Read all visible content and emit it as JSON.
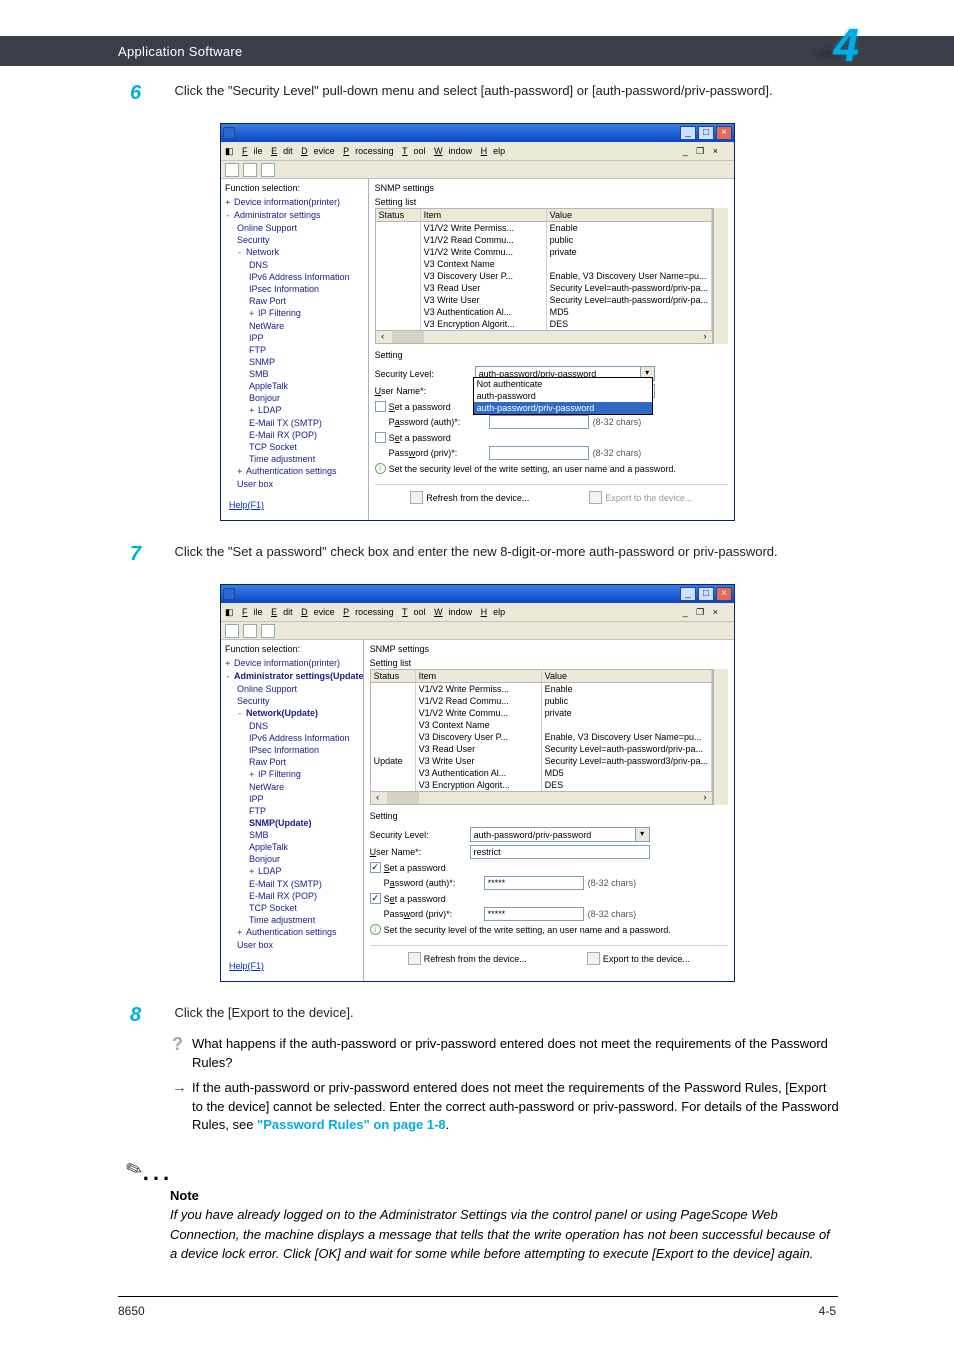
{
  "header": {
    "section": "Application Software",
    "chapter": "4"
  },
  "steps": {
    "s6": {
      "num": "6",
      "text": "Click the \"Security Level\" pull-down menu and select [auth-password] or [auth-password/priv-password]."
    },
    "s7": {
      "num": "7",
      "text": "Click the \"Set a password\" check box and enter the new 8-digit-or-more auth-password or priv-password."
    },
    "s8": {
      "num": "8",
      "text": "Click the [Export to the device].",
      "q": "What happens if the auth-password or priv-password entered does not meet the requirements of the Password Rules?",
      "a_pre": "If the auth-password or priv-password entered does not meet the requirements of the Password Rules, [Export to the device] cannot be selected. Enter the correct auth-password or priv-password. For details of the Password Rules, see ",
      "a_link": "\"Password Rules\" on page 1-8",
      "a_post": "."
    }
  },
  "note": {
    "title": "Note",
    "body": "If you have already logged on to the Administrator Settings via the control panel or using PageScope Web Connection, the machine displays a message that tells that the write operation has not been successful because of a device lock error. Click [OK] and wait for some while before attempting to execute [Export to the device] again."
  },
  "footer": {
    "left": "8650",
    "right": "4-5"
  },
  "app": {
    "menus": [
      "File",
      "Edit",
      "Device",
      "Processing",
      "Tool",
      "Window",
      "Help"
    ],
    "left_label": "Function selection:",
    "tree": {
      "root": "Device information(printer)",
      "admin": "Administrator settings",
      "admin_upd": "Administrator settings(Update",
      "online": "Online Support",
      "security": "Security",
      "network": "Network",
      "network_upd": "Network(Update)",
      "dns": "DNS",
      "ipv6": "IPv6 Address Information",
      "ipsec": "IPsec Information",
      "raw": "Raw Port",
      "ipf": "IP Filtering",
      "netware": "NetWare",
      "ipp": "IPP",
      "ftp": "FTP",
      "snmp": "SNMP",
      "snmp_upd": "SNMP(Update)",
      "smb": "SMB",
      "atalk": "AppleTalk",
      "bonjour": "Bonjour",
      "ldap": "LDAP",
      "etx": "E-Mail TX (SMTP)",
      "erx": "E-Mail RX (POP)",
      "tcp": "TCP Socket",
      "time": "Time adjustment",
      "auth": "Authentication settings",
      "ubox": "User box"
    },
    "rp_title": "SNMP settings",
    "rp_sub1": "Setting list",
    "rp_sub2": "Setting",
    "cols": {
      "status": "Status",
      "item": "Item",
      "value": "Value"
    },
    "rows": [
      {
        "s": "",
        "i": "V1/V2 Write Permiss...",
        "v": "Enable"
      },
      {
        "s": "",
        "i": "V1/V2 Read Commu...",
        "v": "public"
      },
      {
        "s": "",
        "i": "V1/V2 Write Commu...",
        "v": "private"
      },
      {
        "s": "",
        "i": "V3 Context Name",
        "v": ""
      },
      {
        "s": "",
        "i": "V3 Discovery User P...",
        "v": "Enable, V3 Discovery User Name=pu..."
      },
      {
        "s": "",
        "i": "V3 Read User",
        "v": "Security Level=auth-password/priv-pa..."
      },
      {
        "s": "",
        "i": "V3 Write User",
        "v": "Security Level=auth-password/priv-pa..."
      },
      {
        "s": "",
        "i": "V3 Authentication Al...",
        "v": "MD5"
      },
      {
        "s": "",
        "i": "V3 Encryption Algorit...",
        "v": "DES"
      }
    ],
    "rows2": [
      {
        "s": "",
        "i": "V1/V2 Write Permiss...",
        "v": "Enable"
      },
      {
        "s": "",
        "i": "V1/V2 Read Commu...",
        "v": "public"
      },
      {
        "s": "",
        "i": "V1/V2 Write Commu...",
        "v": "private"
      },
      {
        "s": "",
        "i": "V3 Context Name",
        "v": ""
      },
      {
        "s": "",
        "i": "V3 Discovery User P...",
        "v": "Enable, V3 Discovery User Name=pu..."
      },
      {
        "s": "",
        "i": "V3 Read User",
        "v": "Security Level=auth-password/priv-pa..."
      },
      {
        "s": "Update",
        "i": "V3 Write User",
        "v": "Security Level=auth-password3/priv-pa..."
      },
      {
        "s": "",
        "i": "V3 Authentication Al...",
        "v": "MD5"
      },
      {
        "s": "",
        "i": "V3 Encryption Algorit...",
        "v": "DES"
      }
    ],
    "form": {
      "seclevel": "Security Level:",
      "seclevel_val": "auth-password/priv-password",
      "username": "User Name*:",
      "username_val1": "",
      "username_val2": "restrict",
      "setpw": "Set a password",
      "pwauth": "Password (auth)*:",
      "pwpriv": "Password (priv)*:",
      "pwmask": "*****",
      "hint": "(8-32 chars)",
      "info": "Set the security level of the write setting, an user name and a password.",
      "dd_opts": [
        "Not authenticate",
        "auth-password",
        "auth-password/priv-password"
      ]
    },
    "btns": {
      "refresh": "Refresh from the device...",
      "export": "Export to the device..."
    },
    "help": "Help(F1)"
  }
}
